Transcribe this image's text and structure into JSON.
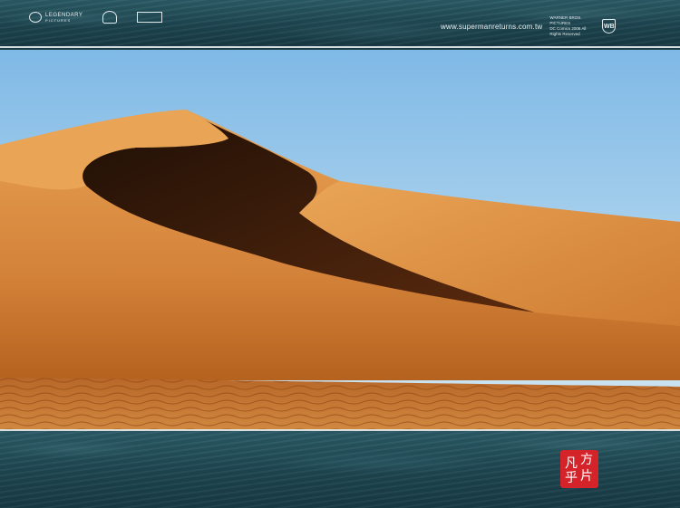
{
  "header": {
    "logo_legendary": "LEGENDARY",
    "logo_legendary_sub": "PICTURES",
    "website": "www.supermanreturns.com.tw",
    "wb_line1": "WARNER BROS. PICTURES",
    "wb_line2": "DC Comics 2006 All Rights Reserved",
    "wb_shield": "WB"
  },
  "stamp": {
    "glyphs": [
      "方",
      "片",
      "凡",
      "乎"
    ]
  },
  "colors": {
    "sky_top": "#87c0e8",
    "sky_bottom": "#cfe6f2",
    "sand_light": "#e39a45",
    "sand_mid": "#cc7a2c",
    "sand_dark": "#8a4412",
    "shadow": "#2a1408",
    "band": "#1d4550",
    "stamp": "#d4242a"
  }
}
